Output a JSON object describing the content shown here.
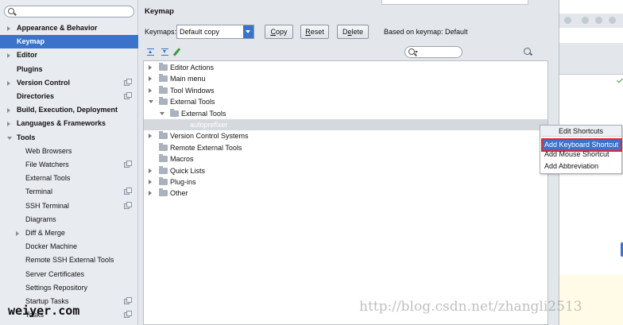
{
  "sidebar": {
    "search_placeholder": "",
    "items": [
      {
        "label": "Appearance & Behavior",
        "arrow": "right",
        "bold": true
      },
      {
        "label": "Keymap",
        "bold": true,
        "selected": true
      },
      {
        "label": "Editor",
        "arrow": "right",
        "bold": true
      },
      {
        "label": "Plugins",
        "bold": true
      },
      {
        "label": "Version Control",
        "arrow": "right",
        "bold": true,
        "project_icon": true
      },
      {
        "label": "Directories",
        "bold": true,
        "project_icon": true
      },
      {
        "label": "Build, Execution, Deployment",
        "arrow": "right",
        "bold": true
      },
      {
        "label": "Languages & Frameworks",
        "arrow": "right",
        "bold": true
      },
      {
        "label": "Tools",
        "arrow": "down",
        "bold": true
      },
      {
        "label": "Web Browsers"
      },
      {
        "label": "File Watchers",
        "project_icon": true
      },
      {
        "label": "External Tools"
      },
      {
        "label": "Terminal",
        "project_icon": true
      },
      {
        "label": "SSH Terminal",
        "project_icon": true
      },
      {
        "label": "Diagrams"
      },
      {
        "label": "Diff & Merge",
        "arrow": "right"
      },
      {
        "label": "Docker Machine"
      },
      {
        "label": "Remote SSH External Tools"
      },
      {
        "label": "Server Certificates"
      },
      {
        "label": "Settings Repository"
      },
      {
        "label": "Startup Tasks",
        "project_icon": true
      },
      {
        "label": "Tasks",
        "project_icon": true
      }
    ]
  },
  "main": {
    "title": "Keymap",
    "keymaps_label": "Keymaps:",
    "keymap_value": "Default copy",
    "buttons": {
      "copy": {
        "pre": "",
        "u": "C",
        "post": "opy"
      },
      "reset": {
        "pre": "",
        "u": "R",
        "post": "eset"
      },
      "delete": {
        "pre": "D",
        "u": "e",
        "post": "lete"
      }
    },
    "based_on": "Based on keymap: Default",
    "filter_placeholder": ""
  },
  "tree": {
    "rows": [
      {
        "label": "Editor Actions",
        "level": 0,
        "arrow": "right",
        "icon": "folder"
      },
      {
        "label": "Main menu",
        "level": 0,
        "arrow": "right",
        "icon": "folder"
      },
      {
        "label": "Tool Windows",
        "level": 0,
        "arrow": "right",
        "icon": "folder"
      },
      {
        "label": "External Tools",
        "level": 0,
        "arrow": "down",
        "icon": "folder"
      },
      {
        "label": "External Tools",
        "level": 1,
        "arrow": "down",
        "icon": "folder"
      },
      {
        "label": "autoprefixer",
        "level": 2,
        "selected": true
      },
      {
        "label": "Version Control Systems",
        "level": 0,
        "arrow": "right",
        "icon": "folder"
      },
      {
        "label": "Remote External Tools",
        "level": 0,
        "icon": "folder"
      },
      {
        "label": "Macros",
        "level": 0,
        "icon": "folder"
      },
      {
        "label": "Quick Lists",
        "level": 0,
        "arrow": "right",
        "icon": "folder"
      },
      {
        "label": "Plug-ins",
        "level": 0,
        "arrow": "right",
        "icon": "folder"
      },
      {
        "label": "Other",
        "level": 0,
        "arrow": "right",
        "icon": "folder"
      }
    ]
  },
  "context_menu": {
    "header": "Edit Shortcuts",
    "items": [
      "Add Keyboard Shortcut",
      "Add Mouse Shortcut",
      "Add Abbreviation"
    ],
    "highlight_color": "#e8232f"
  },
  "watermarks": {
    "left": "weiyer.com",
    "right": "http://blog.csdn.net/zhangli2513"
  },
  "colors": {
    "accent": "#3a73c9",
    "sidebar_bg": "#e8ecf1",
    "highlight_border": "#e8232f"
  }
}
